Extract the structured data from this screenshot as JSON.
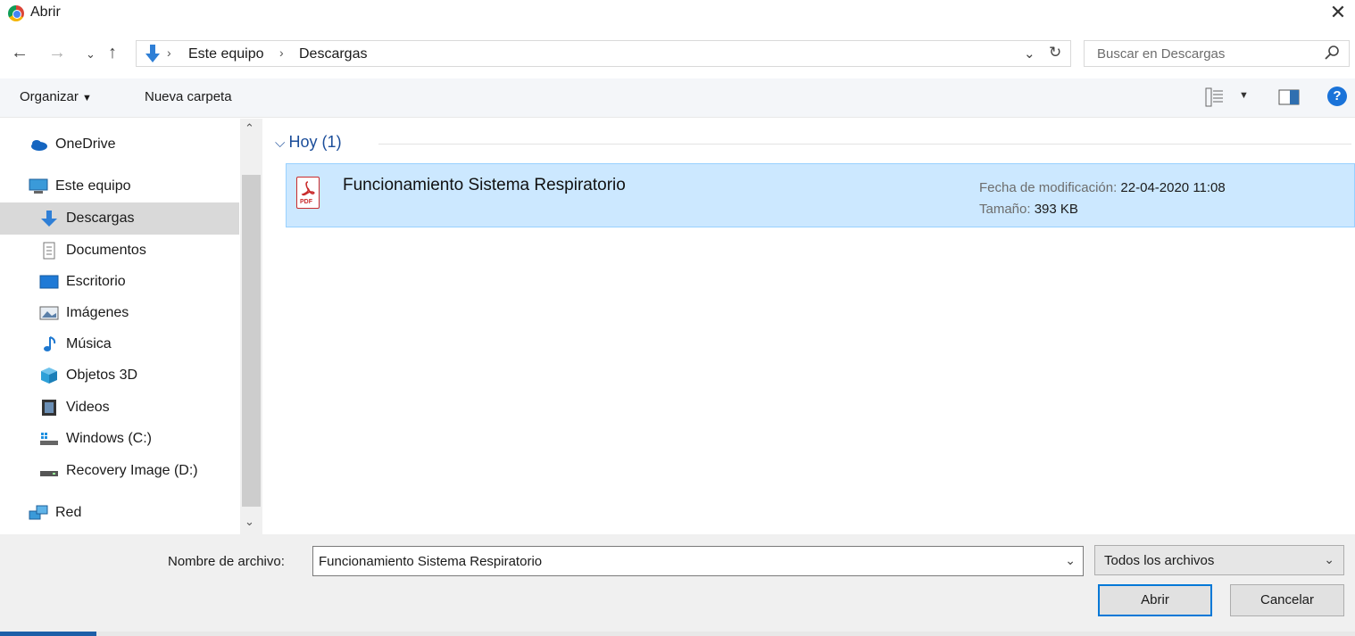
{
  "window": {
    "title": "Abrir"
  },
  "address": {
    "crumbs": [
      "Este equipo",
      "Descargas"
    ],
    "search_placeholder": "Buscar en Descargas"
  },
  "toolbar": {
    "organize_label": "Organizar",
    "new_folder_label": "Nueva carpeta"
  },
  "sidebar": {
    "items": [
      {
        "label": "OneDrive",
        "icon": "cloud-icon"
      },
      {
        "label": "Este equipo",
        "icon": "computer-icon"
      },
      {
        "label": "Descargas",
        "icon": "download-arrow-icon",
        "selected": true
      },
      {
        "label": "Documentos",
        "icon": "documents-icon"
      },
      {
        "label": "Escritorio",
        "icon": "desktop-icon"
      },
      {
        "label": "Imágenes",
        "icon": "pictures-icon"
      },
      {
        "label": "Música",
        "icon": "music-note-icon"
      },
      {
        "label": "Objetos 3D",
        "icon": "cube-3d-icon"
      },
      {
        "label": "Videos",
        "icon": "film-icon"
      },
      {
        "label": "Windows (C:)",
        "icon": "windows-drive-icon"
      },
      {
        "label": "Recovery Image (D:)",
        "icon": "drive-icon"
      },
      {
        "label": "Red",
        "icon": "network-icon"
      }
    ]
  },
  "content": {
    "group_header": "Hoy (1)",
    "files": [
      {
        "name": "Funcionamiento Sistema Respiratorio",
        "icon": "pdf-file-icon",
        "modified_label": "Fecha de modificación:",
        "modified_value": "22-04-2020 11:08",
        "size_label": "Tamaño:",
        "size_value": "393 KB"
      }
    ]
  },
  "footer": {
    "filename_label": "Nombre de archivo:",
    "filename_value": "Funcionamiento Sistema Respiratorio",
    "filetype_value": "Todos los archivos",
    "open_label": "Abrir",
    "cancel_label": "Cancelar"
  },
  "colors": {
    "accent": "#0078d7",
    "selection_bg": "#cce8ff",
    "group_header": "#1c4e9a"
  }
}
